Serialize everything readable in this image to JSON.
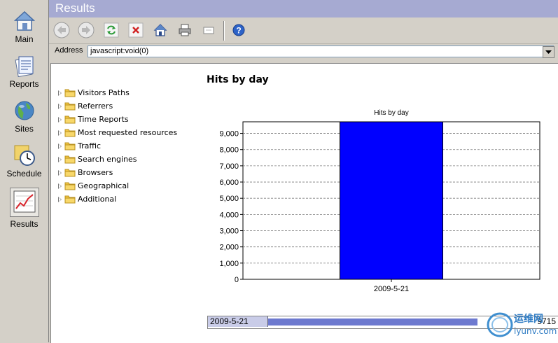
{
  "window": {
    "title": "Results"
  },
  "rail": [
    {
      "label": "Main",
      "icon": "house-icon"
    },
    {
      "label": "Reports",
      "icon": "reports-icon"
    },
    {
      "label": "Sites",
      "icon": "globe-icon"
    },
    {
      "label": "Schedule",
      "icon": "schedule-clock-icon"
    },
    {
      "label": "Results",
      "icon": "results-chart-icon",
      "active": true
    }
  ],
  "toolbar": {
    "buttons": [
      "back-icon",
      "forward-icon",
      "refresh-icon",
      "stop-icon",
      "home-icon",
      "print-icon",
      "email-icon",
      "help-icon"
    ]
  },
  "address": {
    "label": "Address",
    "value": "javascript:void(0)"
  },
  "tree": {
    "items": [
      "Visitors Paths",
      "Referrers",
      "Time Reports",
      "Most requested resources",
      "Traffic",
      "Search engines",
      "Browsers",
      "Geographical",
      "Additional"
    ]
  },
  "report": {
    "heading": "Hits by day"
  },
  "chart_data": {
    "type": "bar",
    "title": "Hits by day",
    "categories": [
      "2009-5-21"
    ],
    "values": [
      9715
    ],
    "ylim": [
      0,
      9715
    ],
    "yticks": [
      0,
      1000,
      2000,
      3000,
      4000,
      5000,
      6000,
      7000,
      8000,
      9000
    ],
    "ytick_labels": [
      "0",
      "1,000",
      "2,000",
      "3,000",
      "4,000",
      "5,000",
      "6,000",
      "7,000",
      "8,000",
      "9,000"
    ],
    "grid": true,
    "bar_color": "#0000ff",
    "xlabel": "",
    "ylabel": ""
  },
  "timeline": {
    "date": "2009-5-21",
    "value": "9715",
    "fraction": 0.62
  },
  "watermark": {
    "text1": "运维网",
    "text2": "iyunv.com"
  }
}
